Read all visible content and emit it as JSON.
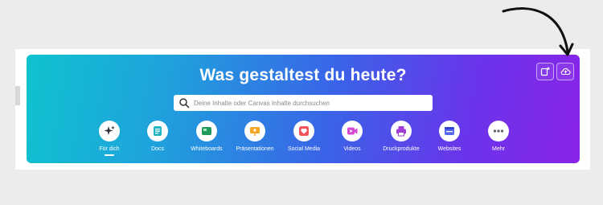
{
  "hero": {
    "headline": "Was gestaltest du heute?",
    "search_placeholder": "Deine Inhalte oder Canvas Inhalte durchsuchen",
    "top_actions": [
      {
        "name": "custom-size-icon"
      },
      {
        "name": "upload-cloud-icon"
      }
    ]
  },
  "categories": [
    {
      "label": "Für dich",
      "icon": "sparkle-icon",
      "selected": true,
      "color": "#2c2f3a"
    },
    {
      "label": "Docs",
      "icon": "docs-icon",
      "color": "#1fb5c4"
    },
    {
      "label": "Whiteboards",
      "icon": "whiteboard-icon",
      "color": "#1f9a5a"
    },
    {
      "label": "Präsentationen",
      "icon": "presentation-icon",
      "color": "#f5a623"
    },
    {
      "label": "Social Media",
      "icon": "heart-icon",
      "color": "#f2545b"
    },
    {
      "label": "Videos",
      "icon": "video-icon",
      "color": "#d54ad1"
    },
    {
      "label": "Druckprodukte",
      "icon": "print-icon",
      "color": "#a23cd6"
    },
    {
      "label": "Websites",
      "icon": "website-icon",
      "color": "#5566f2"
    },
    {
      "label": "Mehr",
      "icon": "more-icon",
      "color": "#5d5f6b"
    }
  ],
  "colors": {
    "gradient_start": "#0fc3cf",
    "gradient_end": "#8a24e8",
    "annotation_arrow": "#111111"
  }
}
